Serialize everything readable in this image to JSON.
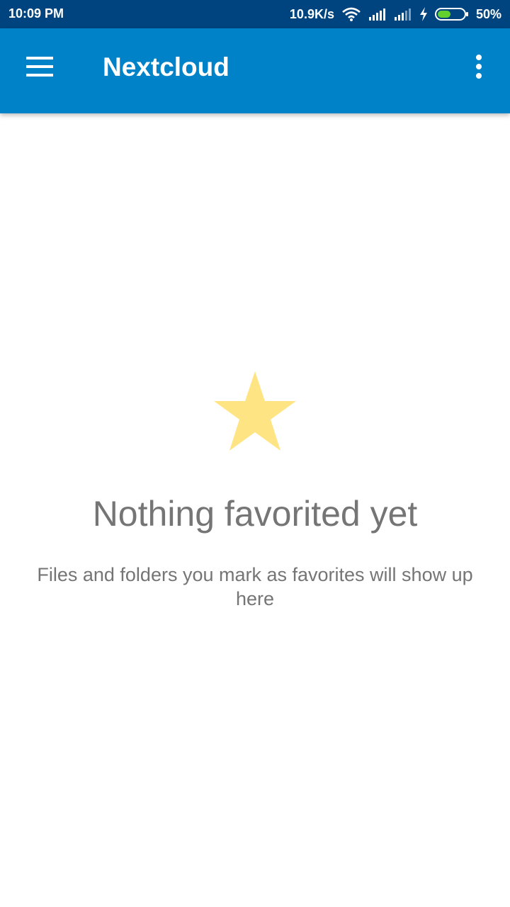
{
  "status_bar": {
    "time": "10:09 PM",
    "network_speed": "10.9K/s",
    "battery_percent": "50%",
    "battery_level": 0.5,
    "icons": [
      "wifi-icon",
      "signal-icon",
      "signal-icon",
      "charging-icon",
      "battery-icon"
    ]
  },
  "app_bar": {
    "title": "Nextcloud",
    "menu_icon": "hamburger-menu-icon",
    "overflow_icon": "more-vert-icon",
    "color": "#0082c9"
  },
  "empty_state": {
    "icon": "star-icon",
    "icon_color": "#ffe483",
    "title": "Nothing favorited yet",
    "description": "Files and folders you mark as favorites will show up here"
  }
}
